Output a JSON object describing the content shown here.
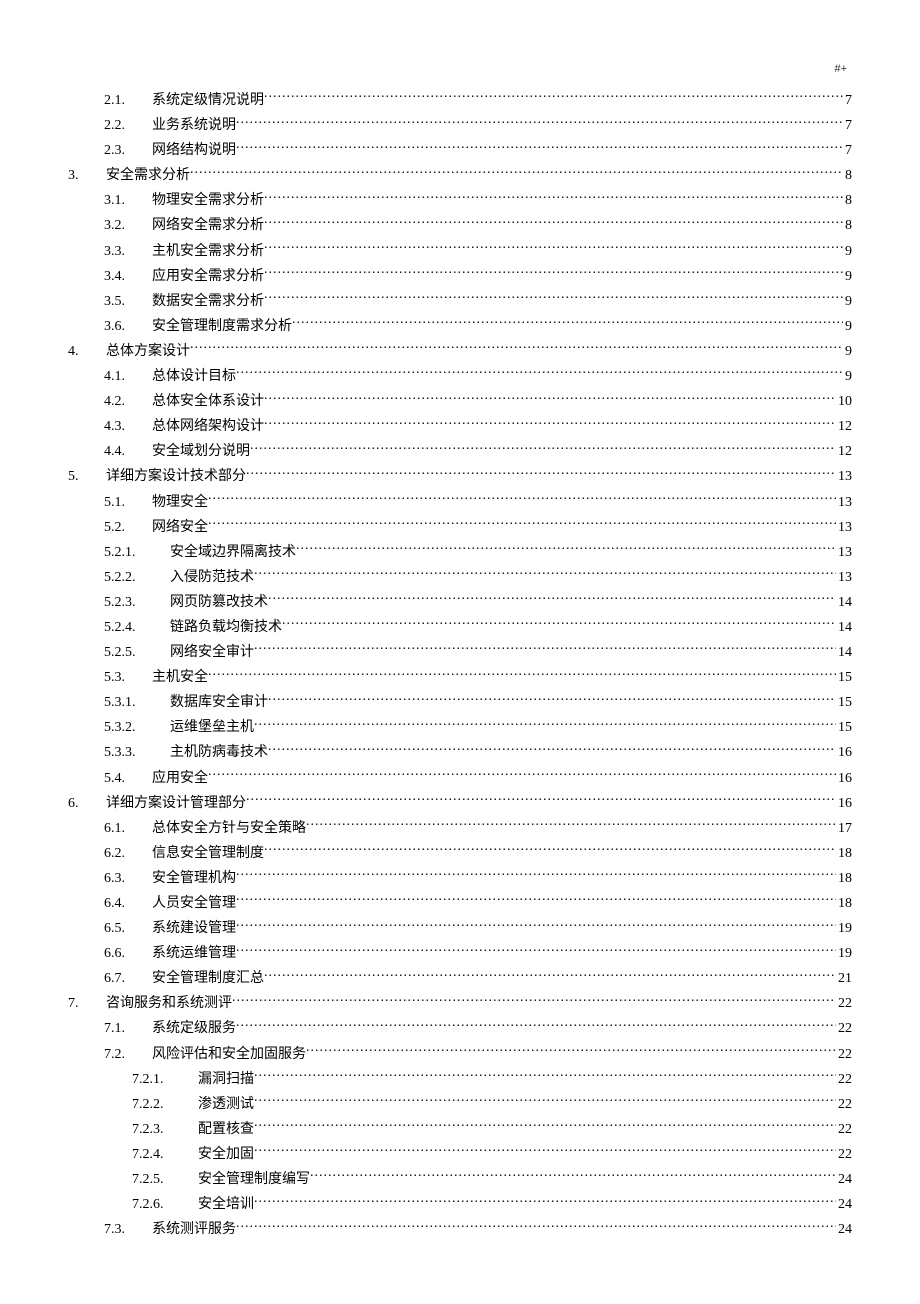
{
  "header_mark": "#+",
  "toc": [
    {
      "level": "lvl2",
      "num": "2.1.",
      "title": "系统定级情况说明",
      "page": "7"
    },
    {
      "level": "lvl2",
      "num": "2.2.",
      "title": "业务系统说明",
      "page": "7"
    },
    {
      "level": "lvl2",
      "num": "2.3.",
      "title": "网络结构说明",
      "page": "7"
    },
    {
      "level": "lvl1",
      "num": "3.",
      "title": "安全需求分析",
      "page": "8"
    },
    {
      "level": "lvl2",
      "num": "3.1.",
      "title": "物理安全需求分析",
      "page": "8"
    },
    {
      "level": "lvl2",
      "num": "3.2.",
      "title": "网络安全需求分析",
      "page": "8"
    },
    {
      "level": "lvl2",
      "num": "3.3.",
      "title": "主机安全需求分析",
      "page": "9"
    },
    {
      "level": "lvl2",
      "num": "3.4.",
      "title": "应用安全需求分析",
      "page": "9"
    },
    {
      "level": "lvl2",
      "num": "3.5.",
      "title": "数据安全需求分析",
      "page": "9"
    },
    {
      "level": "lvl2",
      "num": "3.6.",
      "title": "安全管理制度需求分析",
      "page": "9"
    },
    {
      "level": "lvl1",
      "num": "4.",
      "title": "总体方案设计",
      "page": "9"
    },
    {
      "level": "lvl2",
      "num": "4.1.",
      "title": "总体设计目标",
      "page": "9"
    },
    {
      "level": "lvl2",
      "num": "4.2.",
      "title": "总体安全体系设计",
      "page": "10"
    },
    {
      "level": "lvl2",
      "num": "4.3.",
      "title": "总体网络架构设计",
      "page": "12"
    },
    {
      "level": "lvl2",
      "num": "4.4.",
      "title": "安全域划分说明",
      "page": "12"
    },
    {
      "level": "lvl1",
      "num": "5.",
      "title": "详细方案设计技术部分",
      "page": "13"
    },
    {
      "level": "lvl2",
      "num": "5.1.",
      "title": "物理安全",
      "page": "13"
    },
    {
      "level": "lvl2",
      "num": "5.2.",
      "title": "网络安全",
      "page": "13"
    },
    {
      "level": "lvl3",
      "num": "5.2.1.",
      "title": "安全域边界隔离技术",
      "page": "13"
    },
    {
      "level": "lvl3",
      "num": "5.2.2.",
      "title": "入侵防范技术",
      "page": "13"
    },
    {
      "level": "lvl3",
      "num": "5.2.3.",
      "title": "网页防篡改技术",
      "page": "14"
    },
    {
      "level": "lvl3",
      "num": "5.2.4.",
      "title": "链路负载均衡技术",
      "page": "14"
    },
    {
      "level": "lvl3",
      "num": "5.2.5.",
      "title": "网络安全审计",
      "page": "14"
    },
    {
      "level": "lvl2",
      "num": "5.3.",
      "title": "主机安全",
      "page": "15"
    },
    {
      "level": "lvl3",
      "num": "5.3.1.",
      "title": "数据库安全审计",
      "page": "15"
    },
    {
      "level": "lvl3",
      "num": "5.3.2.",
      "title": "运维堡垒主机",
      "page": "15"
    },
    {
      "level": "lvl3",
      "num": "5.3.3.",
      "title": "主机防病毒技术",
      "page": "16"
    },
    {
      "level": "lvl2",
      "num": "5.4.",
      "title": "应用安全",
      "page": "16"
    },
    {
      "level": "lvl1",
      "num": "6.",
      "title": "详细方案设计管理部分",
      "page": "16"
    },
    {
      "level": "lvl2",
      "num": "6.1.",
      "title": "总体安全方针与安全策略",
      "page": "17"
    },
    {
      "level": "lvl2",
      "num": "6.2.",
      "title": "信息安全管理制度",
      "page": "18"
    },
    {
      "level": "lvl2",
      "num": "6.3.",
      "title": "安全管理机构",
      "page": "18"
    },
    {
      "level": "lvl2",
      "num": "6.4.",
      "title": "人员安全管理",
      "page": "18"
    },
    {
      "level": "lvl2",
      "num": "6.5.",
      "title": "系统建设管理",
      "page": "19"
    },
    {
      "level": "lvl2",
      "num": "6.6.",
      "title": "系统运维管理",
      "page": "19"
    },
    {
      "level": "lvl2",
      "num": "6.7.",
      "title": "安全管理制度汇总",
      "page": "21"
    },
    {
      "level": "lvl1",
      "num": "7.",
      "title": "咨询服务和系统测评",
      "page": "22"
    },
    {
      "level": "lvl2",
      "num": "7.1.",
      "title": "系统定级服务",
      "page": "22"
    },
    {
      "level": "lvl2",
      "num": "7.2.",
      "title": "风险评估和安全加固服务",
      "page": "22"
    },
    {
      "level": "lvl3b",
      "num": "7.2.1.",
      "title": "漏洞扫描",
      "page": "22"
    },
    {
      "level": "lvl3b",
      "num": "7.2.2.",
      "title": "渗透测试",
      "page": "22"
    },
    {
      "level": "lvl3b",
      "num": "7.2.3.",
      "title": "配置核查",
      "page": "22"
    },
    {
      "level": "lvl3b",
      "num": "7.2.4.",
      "title": "安全加固",
      "page": "22"
    },
    {
      "level": "lvl3b",
      "num": "7.2.5.",
      "title": "安全管理制度编写",
      "page": "24"
    },
    {
      "level": "lvl3b",
      "num": "7.2.6.",
      "title": "安全培训",
      "page": "24"
    },
    {
      "level": "lvl2",
      "num": "7.3.",
      "title": "系统测评服务",
      "page": "24"
    }
  ]
}
